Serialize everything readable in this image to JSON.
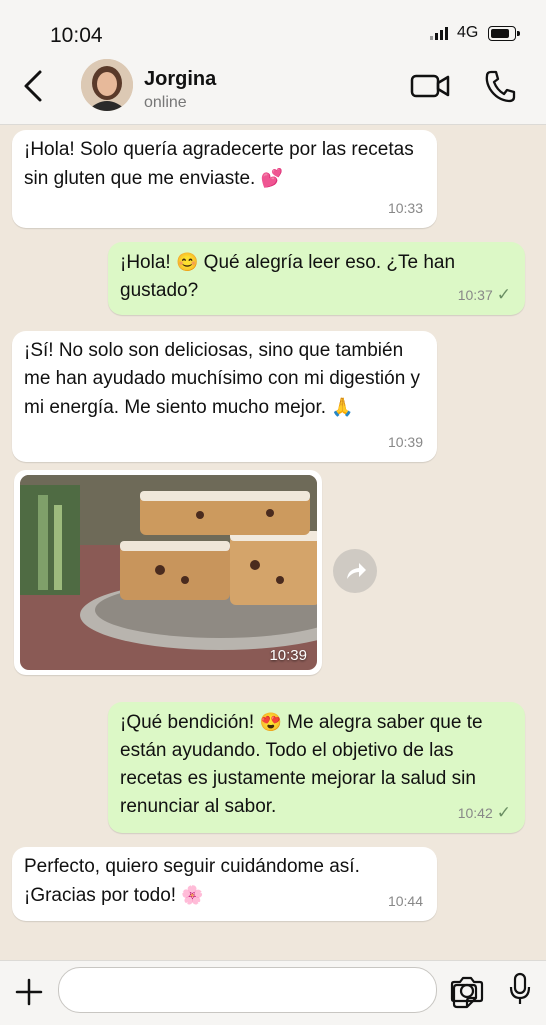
{
  "status_bar": {
    "time": "10:04",
    "network": "4G"
  },
  "header": {
    "contact_name": "Jorgina",
    "contact_status": "online"
  },
  "messages": [
    {
      "direction": "incoming",
      "text": "¡Hola! Solo quería agradecerte por las recetas sin gluten que me enviaste.",
      "emoji": "💕",
      "time": "10:33"
    },
    {
      "direction": "outgoing",
      "text_before_emoji": "¡Hola!",
      "emoji": "😊",
      "text_after_emoji": "Qué alegría leer eso. ¿Te han gustado?",
      "time": "10:37",
      "status": "✓"
    },
    {
      "direction": "incoming",
      "text": "¡Sí! No solo son deliciosas, sino que también me han ayudado muchísimo con mi digestión y mi energía. Me siento mucho mejor.",
      "emoji": "🙏",
      "time": "10:39"
    },
    {
      "direction": "incoming",
      "type": "image",
      "image_description": "bizcocho",
      "time": "10:39"
    },
    {
      "direction": "outgoing",
      "text_before_emoji": "¡Qué bendición!",
      "emoji": "😍",
      "text_after_emoji": "Me alegra saber que te están ayudando. Todo el objetivo de las recetas es justamente mejorar la salud sin renunciar al sabor.",
      "time": "10:42",
      "status": "✓"
    },
    {
      "direction": "incoming",
      "text": "Perfecto, quiero seguir cuidándome así. ¡Gracias por todo!",
      "emoji": "🌸",
      "time": "10:44"
    }
  ],
  "input": {
    "placeholder": ""
  },
  "icons": {
    "back": "chevron-left-icon",
    "video": "video-call-icon",
    "call": "phone-icon",
    "forward": "forward-icon",
    "plus": "plus-icon",
    "sticker": "sticker-icon",
    "camera": "camera-icon",
    "mic": "microphone-icon"
  },
  "colors": {
    "incoming_bubble": "#ffffff",
    "outgoing_bubble": "#dcf8c6",
    "chat_background": "#efe7dc",
    "read_check": "#6b8f64"
  }
}
